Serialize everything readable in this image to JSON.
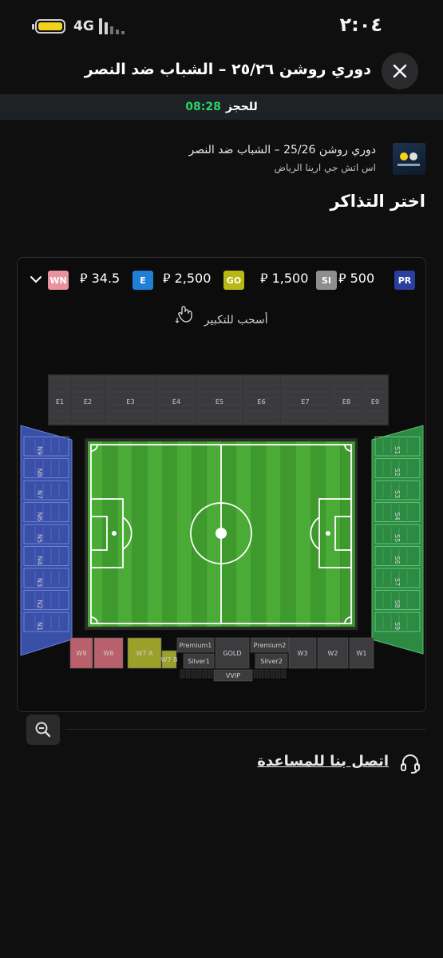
{
  "status_bar": {
    "network": "4G",
    "time": "٢:٠٤",
    "battery_level": 1.0,
    "battery_color": "#f3d21c"
  },
  "header": {
    "title": "دوري روشن ٢٥/٢٦ – الشباب ضد النصر",
    "close_icon": "close-icon"
  },
  "timer": {
    "label": "للحجز",
    "time": "08:28"
  },
  "event": {
    "name": "دوري روشن 25/26 – الشباب ضد النصر",
    "venue": "اس اتش جي ارينا الرياض"
  },
  "section_title": "اختر التذاكر",
  "legend": [
    {
      "code": "PR",
      "price": "500",
      "currency": "⃁",
      "color": "#2b3f9e"
    },
    {
      "code": "SI",
      "price": "1,500",
      "currency": "⃁",
      "color": "#8e8e8e"
    },
    {
      "code": "GO",
      "price": "2,500",
      "currency": "⃁",
      "color": "#b8b815"
    },
    {
      "code": "E",
      "price": "34.5",
      "currency": "⃁",
      "color": "#1e7fd4"
    },
    {
      "code": "WN",
      "price": "",
      "currency": "",
      "color": "#e8939e"
    }
  ],
  "drag_hint": "أسحب للتكبير",
  "stadium": {
    "east_sections": [
      "E1",
      "E2",
      "E3",
      "E4",
      "E5",
      "E6",
      "E7",
      "E8",
      "E9"
    ],
    "north_sections": [
      "N1",
      "N2",
      "N3",
      "N4",
      "N5",
      "N6",
      "N7",
      "N8",
      "N9"
    ],
    "south_sections": [
      "S1",
      "S2",
      "S3",
      "S4",
      "S5",
      "S6",
      "S7",
      "S8",
      "S9"
    ],
    "west_sections": [
      "W9",
      "W8",
      "W7 A",
      "W7 B",
      "Premium1",
      "Silver1",
      "GOLD",
      "Premium2",
      "Silver2",
      "W3",
      "W2",
      "W1",
      "VVIP"
    ],
    "colors": {
      "pitch": "#3f9a2d",
      "north": "#3a4fa8",
      "south": "#2c8a42",
      "west_pink": "#b8606b",
      "west_yellow": "#9aa02a",
      "grey": "#3c3c3e"
    }
  },
  "help": {
    "label": "اتصل بنا للمساعدة",
    "icon": "headset-icon"
  }
}
